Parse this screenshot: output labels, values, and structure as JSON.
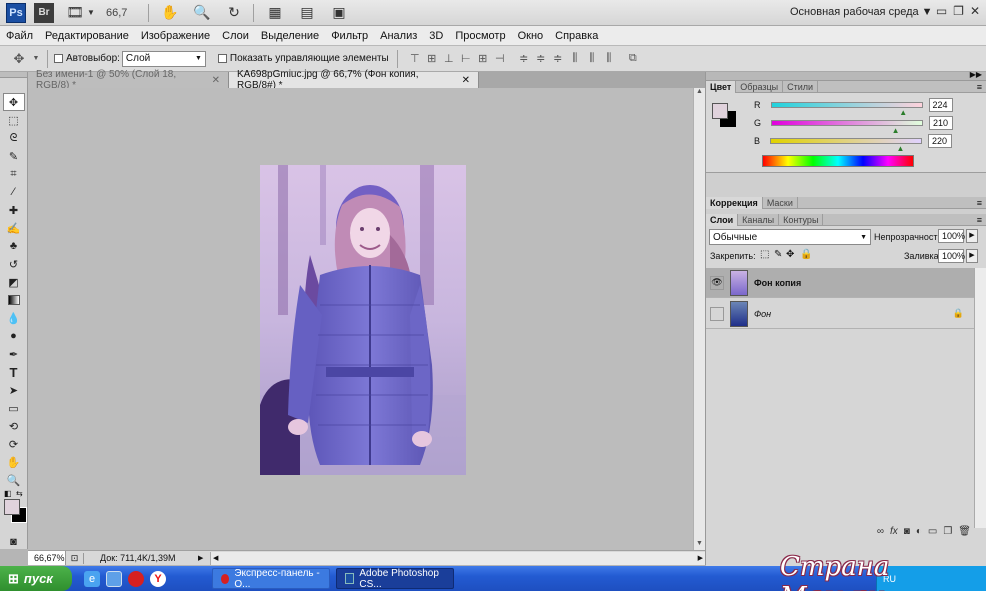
{
  "appbar": {
    "ps_logo": "Ps",
    "br_logo": "Br",
    "zoom": "66,7",
    "workspace": "Основная рабочая среда",
    "win_min": "▭",
    "win_restore": "❐",
    "win_close": "✕"
  },
  "menu": {
    "items": [
      "Файл",
      "Редактирование",
      "Изображение",
      "Слои",
      "Выделение",
      "Фильтр",
      "Анализ",
      "3D",
      "Просмотр",
      "Окно",
      "Справка"
    ]
  },
  "options": {
    "autoselect_label": "Автовыбор:",
    "autoselect_value": "Слой",
    "show_controls_label": "Показать управляющие элементы"
  },
  "tabs": [
    {
      "label": "Без имени-1 @ 50% (Слой 18, RGB/8) *",
      "active": false
    },
    {
      "label": "KA698pGmiuc.jpg @ 66,7% (Фон копия, RGB/8#) *",
      "active": true
    }
  ],
  "status": {
    "zoom": "66,67%",
    "doc": "Док: 711,4K/1,39M"
  },
  "color_panel": {
    "tabs": [
      "Цвет",
      "Образцы",
      "Стили"
    ],
    "channels": [
      {
        "label": "R",
        "value": "224",
        "level": 0.878
      },
      {
        "label": "G",
        "value": "210",
        "level": 0.824
      },
      {
        "label": "B",
        "value": "220",
        "level": 0.863
      }
    ],
    "fg_color": "#e0d2dc",
    "bg_color": "#000000"
  },
  "adjust_panel": {
    "tabs": [
      "Коррекция",
      "Маски"
    ]
  },
  "layers_panel": {
    "tabs": [
      "Слои",
      "Каналы",
      "Контуры"
    ],
    "blend_mode": "Обычные",
    "opacity_label": "Непрозрачность:",
    "opacity_value": "100%",
    "lock_label": "Закрепить:",
    "fill_label": "Заливка:",
    "fill_value": "100%",
    "layers": [
      {
        "name": "Фон копия",
        "visible": true,
        "selected": true,
        "locked": false
      },
      {
        "name": "Фон",
        "visible": false,
        "selected": false,
        "locked": true
      }
    ]
  },
  "taskbar": {
    "start": "пуск",
    "tasks": [
      {
        "label": "Экспресс-панель - О..."
      },
      {
        "label": "Adobe Photoshop CS..."
      }
    ],
    "tray_lang": "RU"
  },
  "watermark": "Страна Мам.ру"
}
